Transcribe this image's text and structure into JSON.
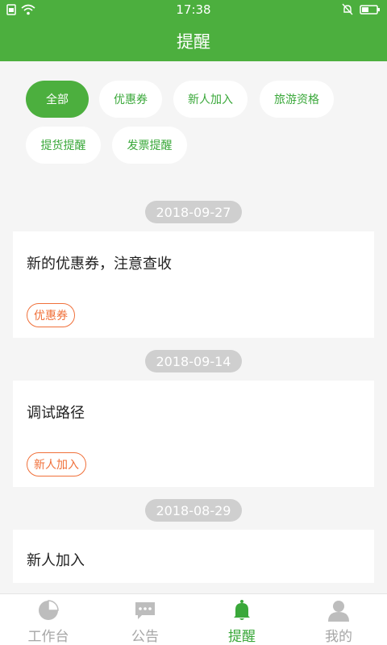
{
  "status_bar": {
    "time": "17:38"
  },
  "header": {
    "title": "提醒"
  },
  "filters": {
    "chips": [
      {
        "label": "全部",
        "active": true
      },
      {
        "label": "优惠券",
        "active": false
      },
      {
        "label": "新人加入",
        "active": false
      },
      {
        "label": "旅游资格",
        "active": false
      },
      {
        "label": "提货提醒",
        "active": false
      },
      {
        "label": "发票提醒",
        "active": false
      }
    ]
  },
  "feed": [
    {
      "date": "2018-09-27",
      "title": "新的优惠券，注意查收",
      "tag": "优惠券"
    },
    {
      "date": "2018-09-14",
      "title": "调试路径",
      "tag": "新人加入"
    },
    {
      "date": "2018-08-29",
      "title": "新人加入",
      "tag": ""
    }
  ],
  "bottom_nav": {
    "items": [
      {
        "label": "工作台",
        "icon": "pie-chart-icon",
        "active": false
      },
      {
        "label": "公告",
        "icon": "chat-bubble-icon",
        "active": false
      },
      {
        "label": "提醒",
        "icon": "bell-icon",
        "active": true
      },
      {
        "label": "我的",
        "icon": "person-icon",
        "active": false
      }
    ]
  },
  "colors": {
    "accent": "#4caf3e",
    "tag": "#f0703a",
    "date_pill": "#cfcfcf",
    "inactive": "#a6a6a6"
  }
}
